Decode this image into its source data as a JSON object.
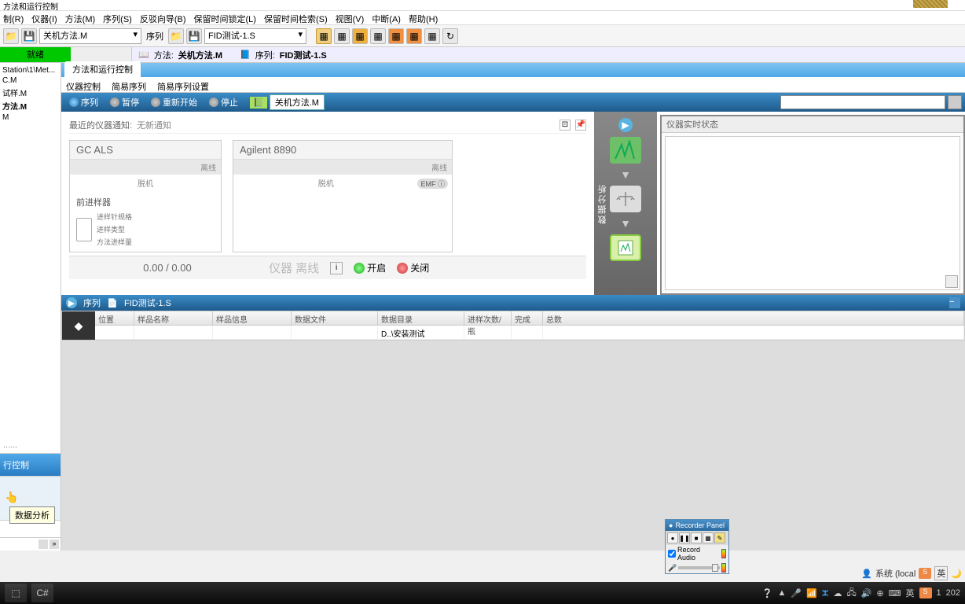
{
  "window": {
    "title": "方法和运行控制"
  },
  "menu": [
    "制(R)",
    "仪器(I)",
    "方法(M)",
    "序列(S)",
    "反驳向导(B)",
    "保留时间锁定(L)",
    "保留时间检索(S)",
    "视图(V)",
    "中断(A)",
    "帮助(H)"
  ],
  "toolbar": {
    "method_label": "关机方法.M",
    "seq_label": "序列",
    "seq_value": "FID测试-1.S"
  },
  "status": {
    "ready": "就绪",
    "method_prefix": "方法:",
    "method_value": "关机方法.M",
    "seq_prefix": "序列:",
    "seq_value": "FID测试-1.S"
  },
  "tree": {
    "header": "Station\\1\\Met...",
    "items": [
      "C.M",
      "试样.M",
      "方法.M",
      "M"
    ]
  },
  "nav": {
    "active": "行控制",
    "tooltip": "数据分析"
  },
  "tabs": {
    "main": "方法和运行控制"
  },
  "subtabs": [
    "仪器控制",
    "简易序列",
    "简易序列设置"
  ],
  "actions": {
    "sequence": "序列",
    "pause": "暂停",
    "restart": "重新开始",
    "stop": "停止",
    "method": "关机方法.M"
  },
  "notif": {
    "label": "最近的仪器通知:",
    "value": "无新通知"
  },
  "cards": {
    "als": {
      "title": "GC ALS",
      "status": "离线",
      "mode": "脱机",
      "heading": "前进样器",
      "labels": [
        "进样针规格",
        "进样类型",
        "方法进样量"
      ]
    },
    "gc": {
      "title": "Agilent 8890",
      "status": "离线",
      "mode": "脱机",
      "emf": "EMF"
    }
  },
  "footer": {
    "progress": "0.00 / 0.00",
    "status": "仪器 离线",
    "on": "开启",
    "off": "关闭"
  },
  "flow": {
    "label": "数据分析"
  },
  "rtstatus": {
    "title": "仪器实时状态"
  },
  "seq": {
    "label": "序列",
    "value": "FID测试-1.S"
  },
  "table": {
    "headers": [
      "位置",
      "样品名称",
      "样品信息",
      "数据文件",
      "数据目录",
      "进样次数/瓶",
      "完成",
      "总数"
    ],
    "row": {
      "datadir": "D..\\安装测试"
    }
  },
  "recorder": {
    "title": "Recorder Panel",
    "audio": "Record Audio"
  },
  "user": {
    "label": "系统 (local"
  },
  "tray": {
    "time": "1",
    "date": "202"
  }
}
